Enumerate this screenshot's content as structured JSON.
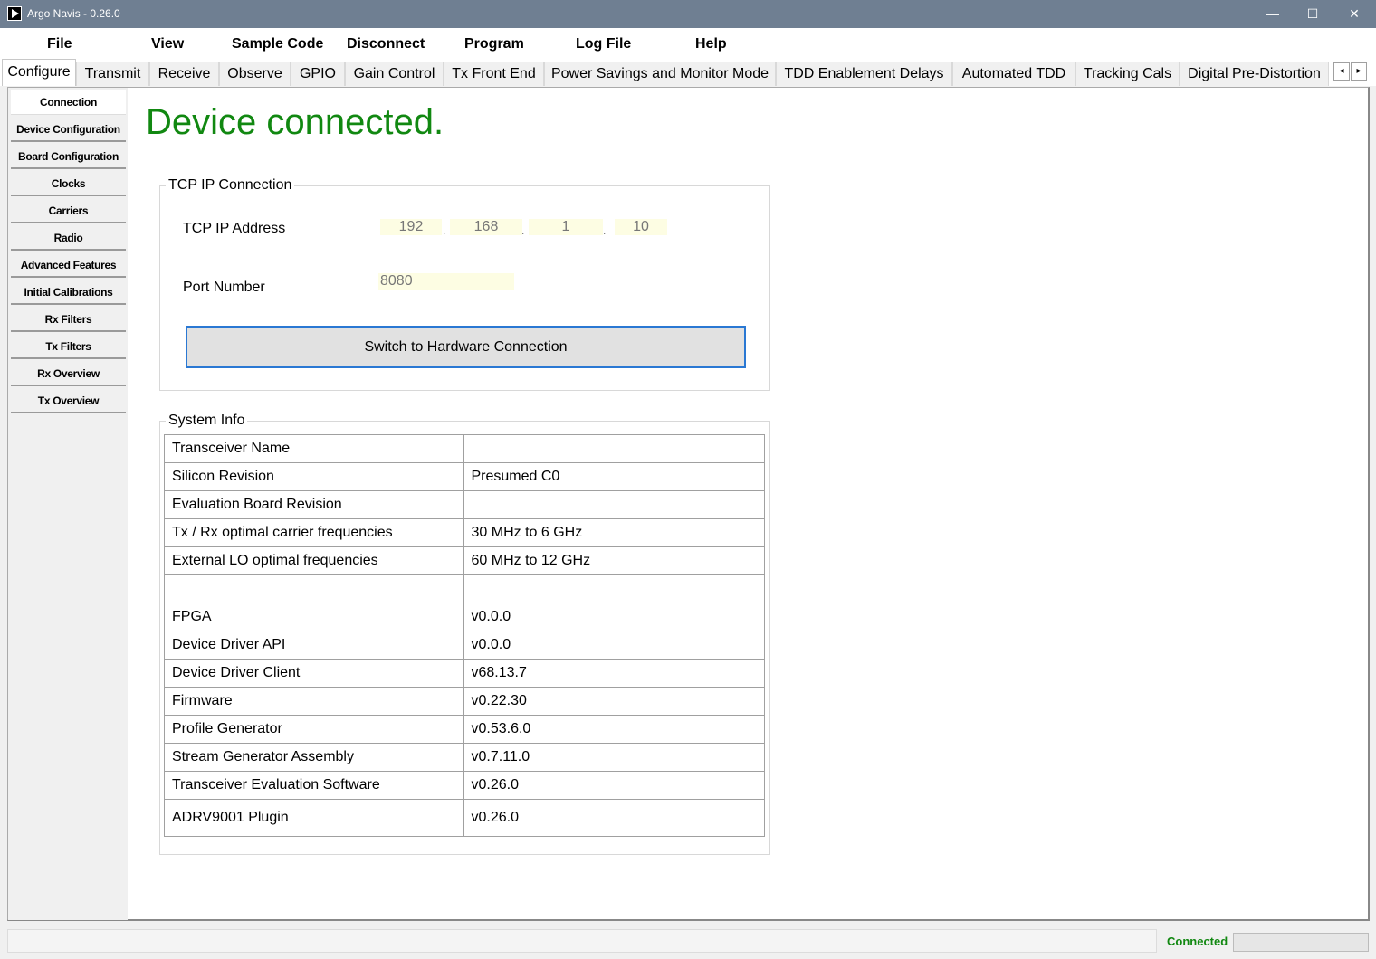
{
  "window": {
    "title": "Argo Navis - 0.26.0",
    "minimize": "—",
    "maximize": "☐",
    "close": "✕"
  },
  "menu": [
    "File",
    "View",
    "Sample Code",
    "Disconnect",
    "Program",
    "Log File",
    "Help"
  ],
  "tabs": [
    "Configure",
    "Transmit",
    "Receive",
    "Observe",
    "GPIO",
    "Gain Control",
    "Tx Front End",
    "Power Savings and Monitor Mode",
    "TDD Enablement Delays",
    "Automated TDD",
    "Tracking Cals",
    "Digital Pre-Distortion"
  ],
  "tab_scroll": {
    "left": "◂",
    "right": "▸"
  },
  "side_tabs": [
    "Connection",
    "Device Configuration",
    "Board Configuration",
    "Clocks",
    "Carriers",
    "Radio",
    "Advanced Features",
    "Initial Calibrations",
    "Rx Filters",
    "Tx Filters",
    "Rx Overview",
    "Tx Overview"
  ],
  "status_heading": "Device connected.",
  "status_color": "#118811",
  "tcp": {
    "title": "TCP IP Connection",
    "ip_label": "TCP IP Address",
    "ip": [
      "192",
      "168",
      "1",
      "10"
    ],
    "ip_sep": ".",
    "port_label": "Port Number",
    "port": "8080",
    "switch_button": "Switch to Hardware Connection"
  },
  "system_info": {
    "title": "System Info",
    "rows": [
      [
        "Transceiver Name",
        ""
      ],
      [
        "Silicon Revision",
        "Presumed C0"
      ],
      [
        "Evaluation Board Revision",
        ""
      ],
      [
        "Tx / Rx optimal carrier frequencies",
        "30 MHz to 6 GHz"
      ],
      [
        "External LO optimal frequencies",
        "60 MHz to 12 GHz"
      ],
      [
        "",
        ""
      ],
      [
        "FPGA",
        "v0.0.0"
      ],
      [
        "Device Driver API",
        "v0.0.0"
      ],
      [
        "Device Driver Client",
        "v68.13.7"
      ],
      [
        "Firmware",
        "v0.22.30"
      ],
      [
        "Profile Generator",
        "v0.53.6.0"
      ],
      [
        "Stream Generator Assembly",
        "v0.7.11.0"
      ],
      [
        "Transceiver Evaluation Software",
        "v0.26.0"
      ],
      [
        "ADRV9001 Plugin",
        "v0.26.0"
      ]
    ]
  },
  "statusbar": {
    "text": "Connected"
  }
}
